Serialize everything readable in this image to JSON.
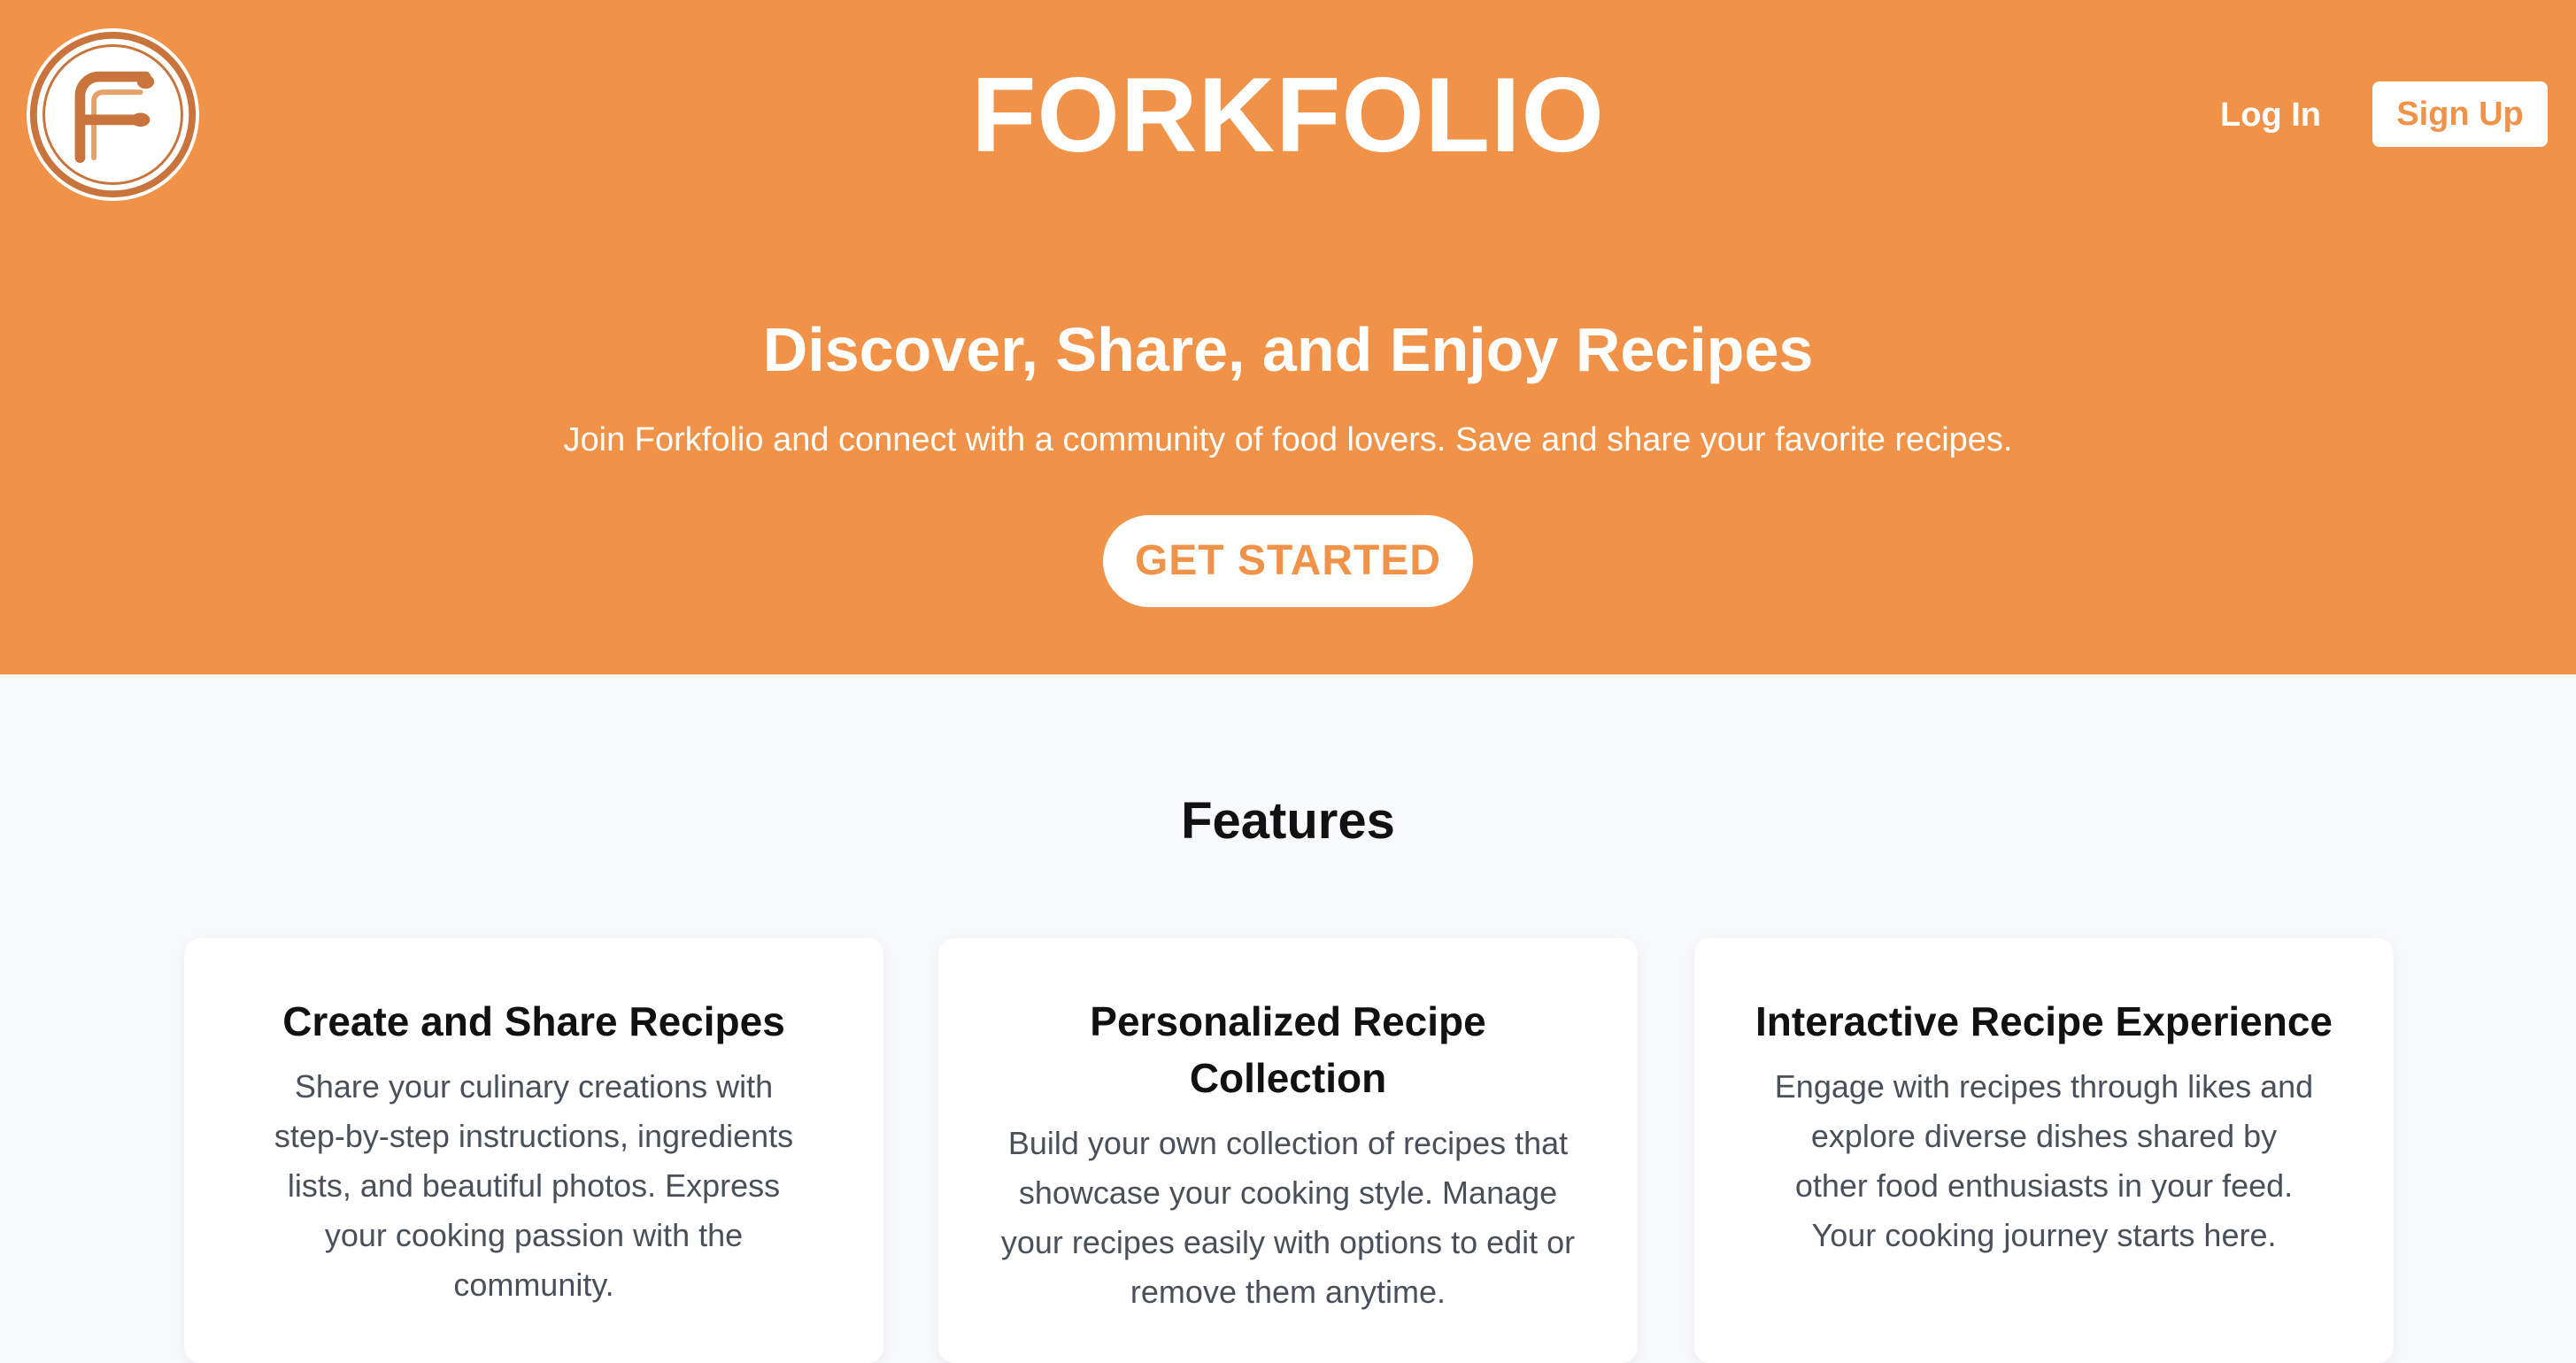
{
  "header": {
    "logo_icon": "forkfolio-logo",
    "brand": "FORKFOLIO",
    "login_label": "Log In",
    "signup_label": "Sign Up"
  },
  "hero": {
    "title": "Discover, Share, and Enjoy Recipes",
    "subtitle": "Join Forkfolio and connect with a community of food lovers. Save and share your favorite recipes.",
    "cta_label": "GET STARTED"
  },
  "features": {
    "title": "Features",
    "cards": [
      {
        "title": "Create and Share Recipes",
        "description": "Share your culinary creations with step-by-step instructions, ingredients lists, and beautiful photos. Express your cooking passion with the community."
      },
      {
        "title": "Personalized Recipe Collection",
        "description": "Build your own collection of recipes that showcase your cooking style. Manage your recipes easily with options to edit or remove them anytime."
      },
      {
        "title": "Interactive Recipe Experience",
        "description": "Engage with recipes through likes and explore diverse dishes shared by other food enthusiasts in your feed. Your cooking journey starts here."
      }
    ]
  },
  "colors": {
    "accent": "#f09247",
    "background": "#f8f9fb",
    "card": "#ffffff",
    "heading": "#111111",
    "body_text": "#4a5059"
  }
}
